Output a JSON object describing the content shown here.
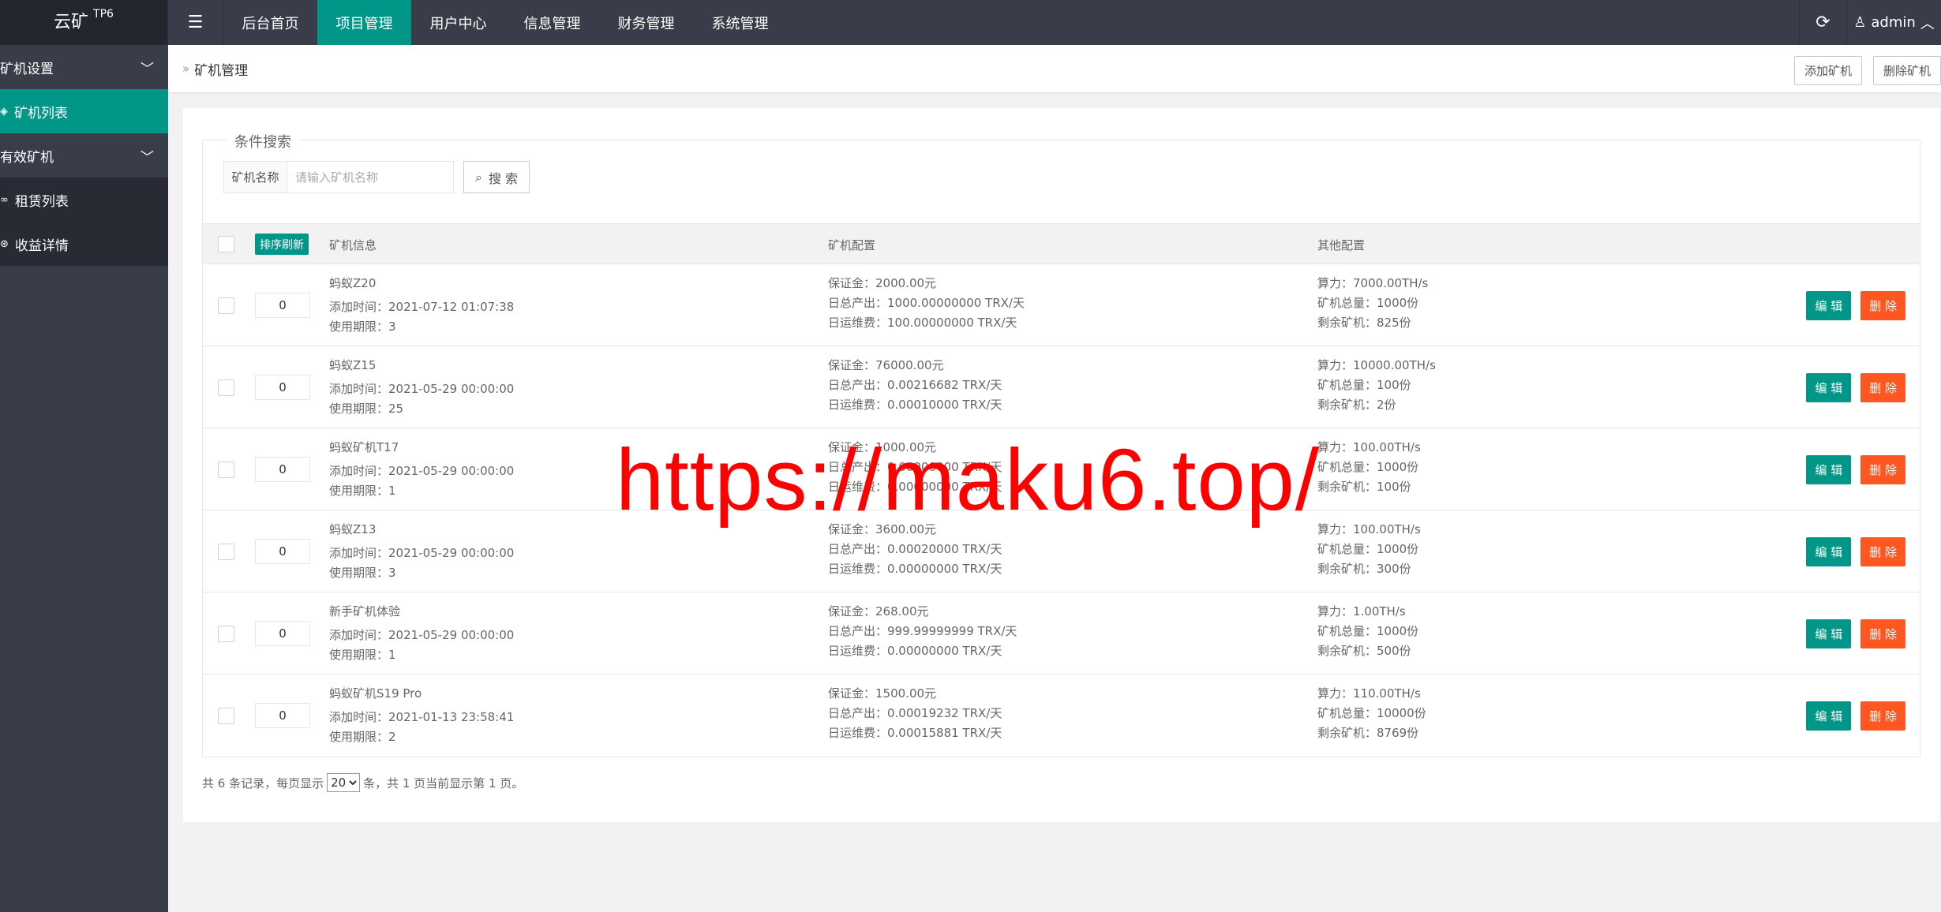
{
  "logo": {
    "name": "云矿",
    "sup": "TP6"
  },
  "nav": {
    "toggle_icon": "menu-icon",
    "items": [
      {
        "label": "后台首页"
      },
      {
        "label": "项目管理",
        "active": true
      },
      {
        "label": "用户中心"
      },
      {
        "label": "信息管理"
      },
      {
        "label": "财务管理"
      },
      {
        "label": "系统管理"
      }
    ],
    "user": "admin"
  },
  "sidebar": {
    "groups": [
      {
        "label": "矿机设置",
        "items": [
          {
            "label": "矿机列表",
            "active": true
          }
        ]
      },
      {
        "label": "有效矿机",
        "items": [
          {
            "label": "租赁列表"
          },
          {
            "label": "收益详情"
          }
        ]
      }
    ]
  },
  "breadcrumb": {
    "current": "矿机管理"
  },
  "header_actions": {
    "add": "添加矿机",
    "delete": "删除矿机"
  },
  "search": {
    "legend": "条件搜索",
    "label": "矿机名称",
    "placeholder": "请输入矿机名称",
    "button": "搜 索"
  },
  "table": {
    "sort_button": "排序刷新",
    "headers": {
      "info": "矿机信息",
      "config": "矿机配置",
      "other": "其他配置"
    },
    "edit_label": "编 辑",
    "delete_label": "删 除",
    "rows": [
      {
        "sort": "0",
        "name": "蚂蚁Z20",
        "add_time": "添加时间：2021-07-12 01:07:38",
        "period": "使用期限：3",
        "deposit": "保证金：2000.00元",
        "daily_output": "日总产出：1000.00000000 TRX/天",
        "daily_fee": "日运维费：100.00000000 TRX/天",
        "hashrate": "算力：7000.00TH/s",
        "total": "矿机总量：1000份",
        "remaining": "剩余矿机：825份"
      },
      {
        "sort": "0",
        "name": "蚂蚁Z15",
        "add_time": "添加时间：2021-05-29 00:00:00",
        "period": "使用期限：25",
        "deposit": "保证金：76000.00元",
        "daily_output": "日总产出：0.00216682 TRX/天",
        "daily_fee": "日运维费：0.00010000 TRX/天",
        "hashrate": "算力：10000.00TH/s",
        "total": "矿机总量：100份",
        "remaining": "剩余矿机：2份"
      },
      {
        "sort": "0",
        "name": "蚂蚁矿机T17",
        "add_time": "添加时间：2021-05-29 00:00:00",
        "period": "使用期限：1",
        "deposit": "保证金：1000.00元",
        "daily_output": "日总产出：0.00000000 TRX/天",
        "daily_fee": "日运维费：0.00000000 TRX/天",
        "hashrate": "算力：100.00TH/s",
        "total": "矿机总量：1000份",
        "remaining": "剩余矿机：100份"
      },
      {
        "sort": "0",
        "name": "蚂蚁Z13",
        "add_time": "添加时间：2021-05-29 00:00:00",
        "period": "使用期限：3",
        "deposit": "保证金：3600.00元",
        "daily_output": "日总产出：0.00020000 TRX/天",
        "daily_fee": "日运维费：0.00000000 TRX/天",
        "hashrate": "算力：100.00TH/s",
        "total": "矿机总量：1000份",
        "remaining": "剩余矿机：300份"
      },
      {
        "sort": "0",
        "name": "新手矿机体验",
        "add_time": "添加时间：2021-05-29 00:00:00",
        "period": "使用期限：1",
        "deposit": "保证金：268.00元",
        "daily_output": "日总产出：999.99999999 TRX/天",
        "daily_fee": "日运维费：0.00000000 TRX/天",
        "hashrate": "算力：1.00TH/s",
        "total": "矿机总量：1000份",
        "remaining": "剩余矿机：500份"
      },
      {
        "sort": "0",
        "name": "蚂蚁矿机S19 Pro",
        "add_time": "添加时间：2021-01-13 23:58:41",
        "period": "使用期限：2",
        "deposit": "保证金：1500.00元",
        "daily_output": "日总产出：0.00019232 TRX/天",
        "daily_fee": "日运维费：0.00015881 TRX/天",
        "hashrate": "算力：110.00TH/s",
        "total": "矿机总量：10000份",
        "remaining": "剩余矿机：8769份"
      }
    ]
  },
  "pager": {
    "prefix": "共 6 条记录，每页显示",
    "page_size": "20",
    "suffix": "条，共 1 页当前显示第 1 页。"
  },
  "watermark": "https://maku6.top/",
  "colors": {
    "primary": "#009688",
    "danger": "#ff5722",
    "topbar": "#393d49"
  }
}
